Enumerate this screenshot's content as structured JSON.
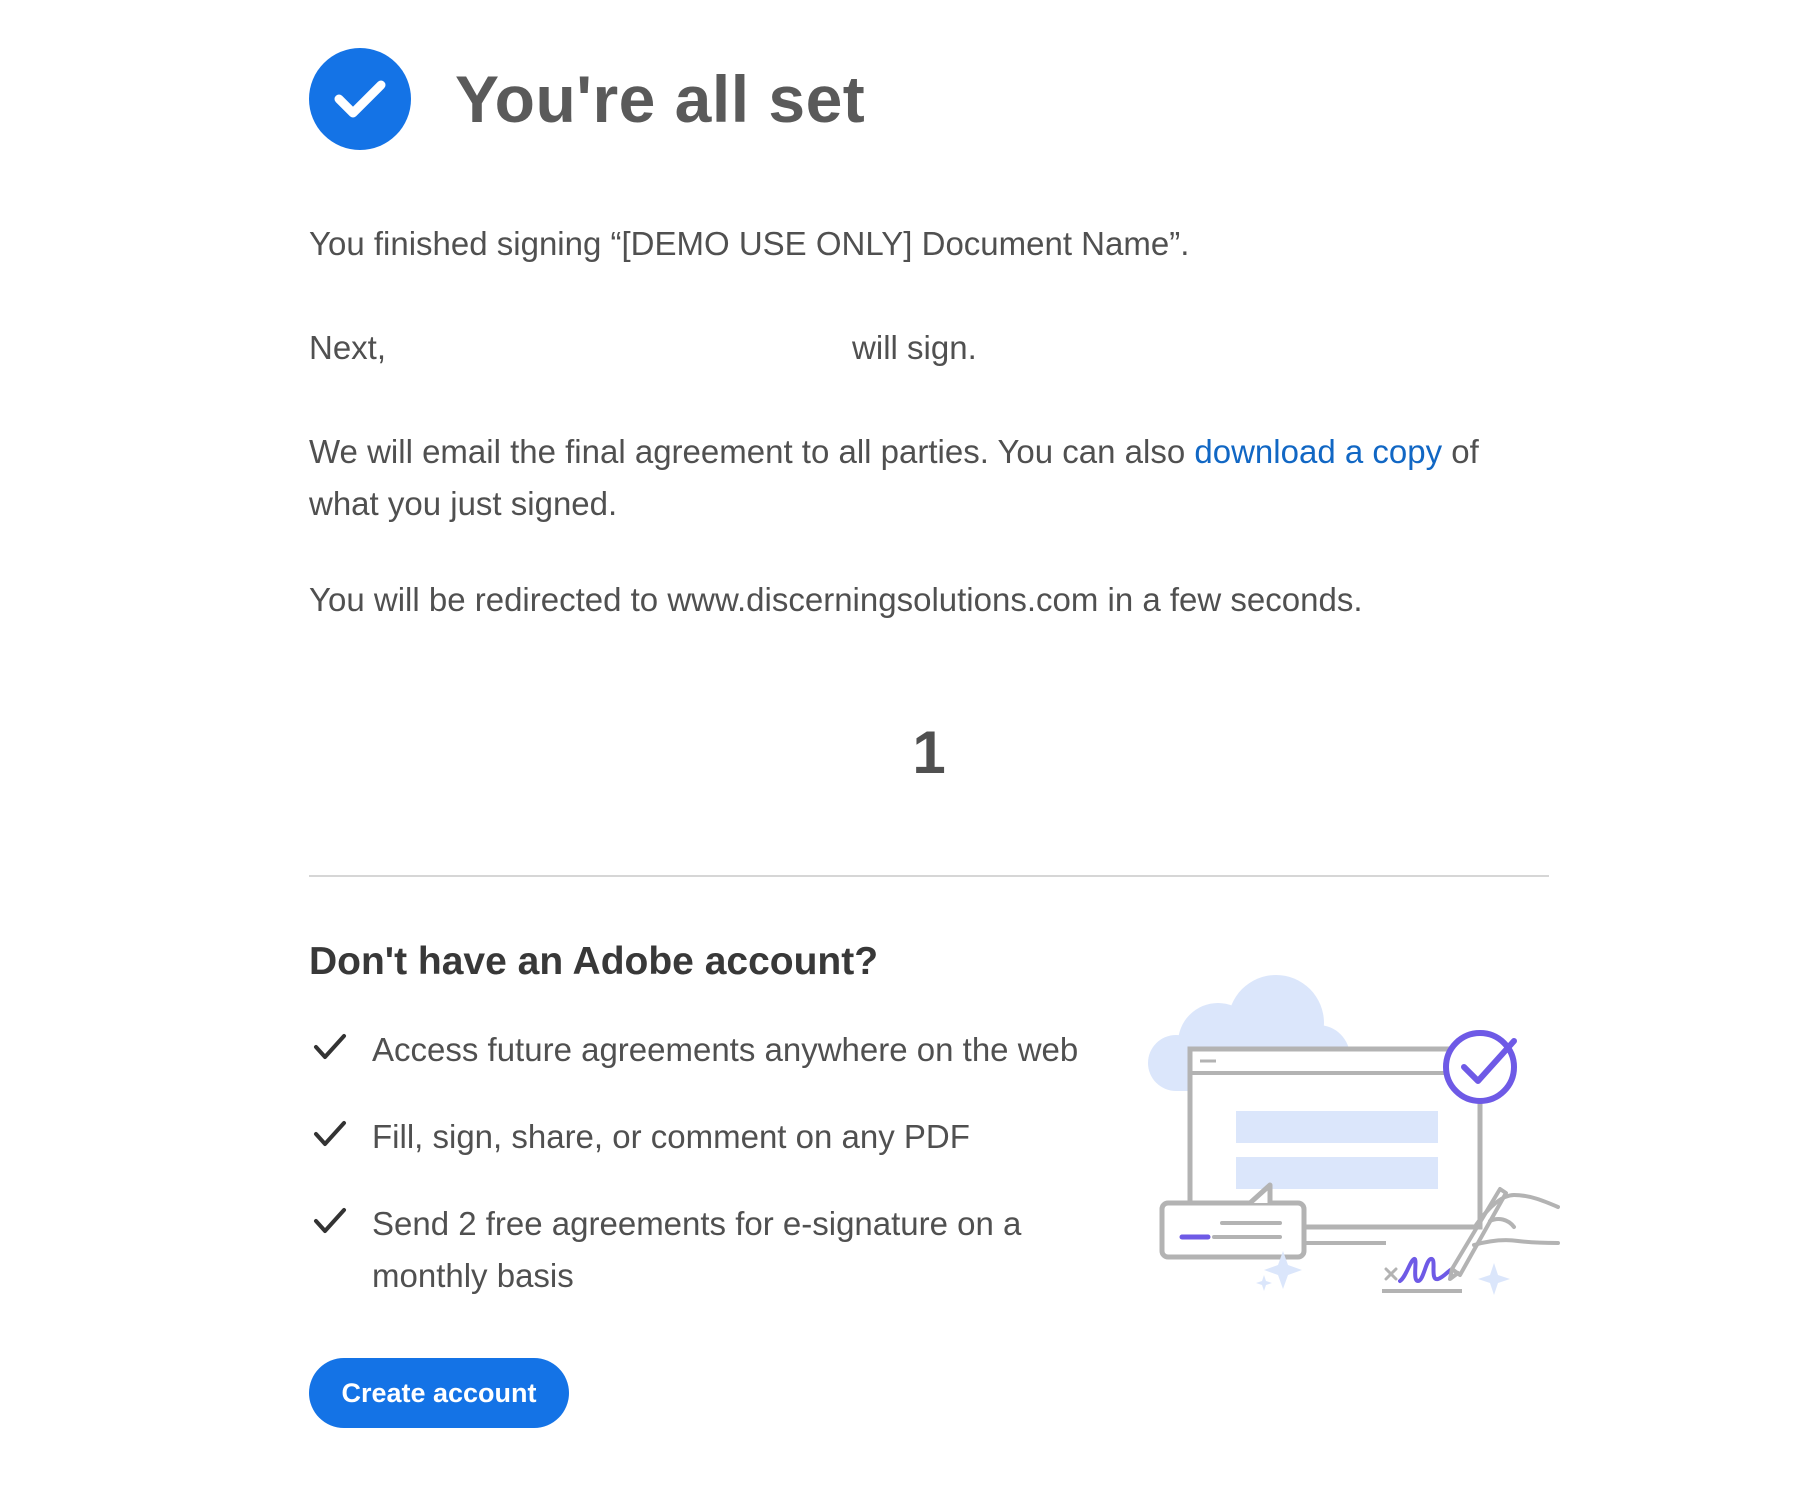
{
  "header": {
    "title": "You're all set"
  },
  "messages": {
    "finished": "You finished signing “[DEMO USE ONLY] Document Name”.",
    "next_prefix": "Next,",
    "next_suffix": "will sign.",
    "email_prefix": "We will email the final agreement to all parties. You can also ",
    "download_link": "download a copy",
    "email_suffix": " of what you just signed.",
    "redirect": "You will be redirected to www.discerningsolutions.com in a few seconds."
  },
  "countdown": "1",
  "promo": {
    "title": "Don't have an Adobe account?",
    "benefits": [
      "Access future agreements anywhere on the web",
      "Fill, sign, share, or comment on any PDF",
      "Send 2 free agreements for e-signature on a monthly basis"
    ],
    "button_label": "Create account"
  },
  "colors": {
    "accent": "#1473e6",
    "link": "#1167c4",
    "illustration_purple": "#6e5ae6",
    "illustration_light_blue": "#dbe6fb"
  },
  "icons": {
    "success": "check-circle-icon",
    "benefit": "checkmark-icon"
  }
}
